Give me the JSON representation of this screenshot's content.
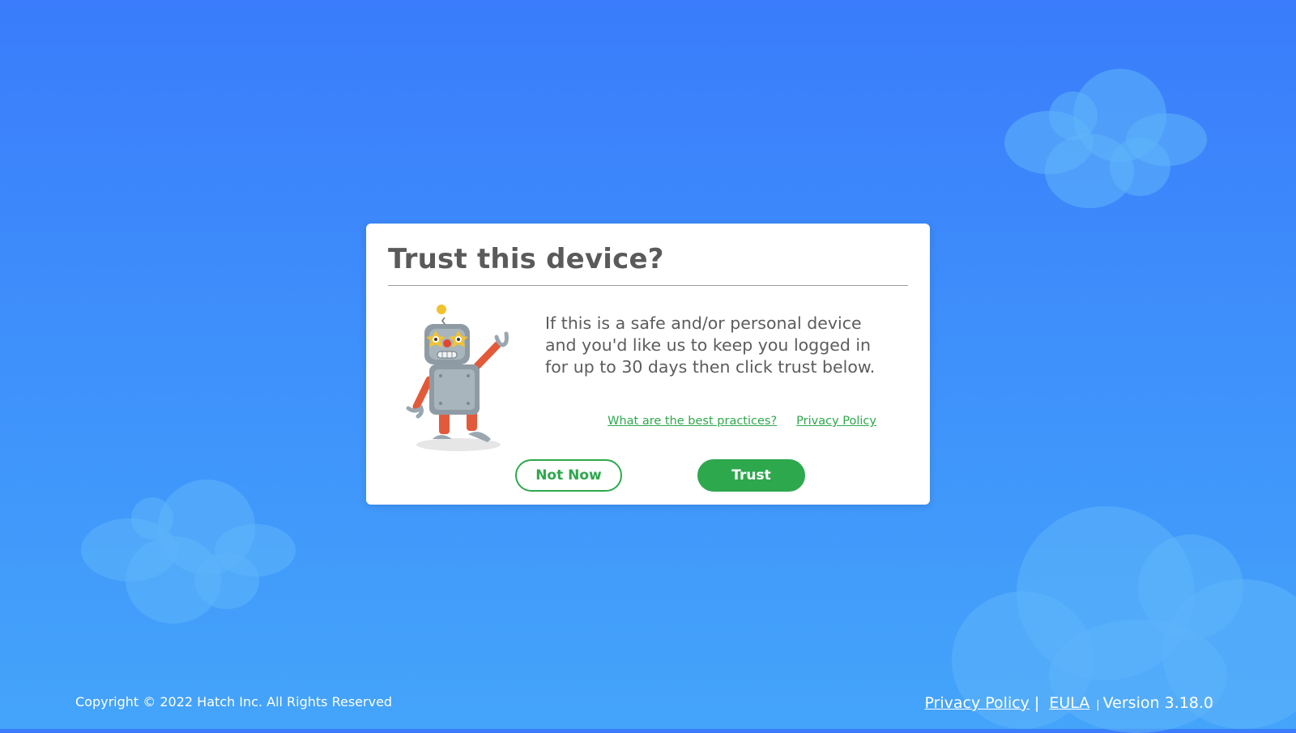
{
  "dialog": {
    "title": "Trust this device?",
    "message": "If this is a safe and/or personal device and you'd like us to keep you logged in for up to 30 days then click trust below.",
    "best_practices_link": "What are the best practices?",
    "privacy_link": "Privacy Policy",
    "not_now_label": "Not Now",
    "trust_label": "Trust",
    "mascot_icon": "robot-mascot-icon"
  },
  "footer": {
    "copyright": "Copyright © 2022 Hatch Inc. All Rights Reserved",
    "privacy_link": "Privacy Policy",
    "separator": "|",
    "eula_link": "EULA",
    "separator_small": "|",
    "version": "Version 3.18.0"
  },
  "colors": {
    "background_top": "#3a7cfb",
    "background_bottom": "#44a4fa",
    "accent_green": "#2ea84d",
    "title_gray": "#5a5a5a"
  }
}
